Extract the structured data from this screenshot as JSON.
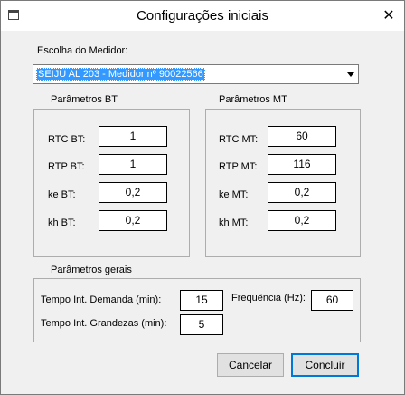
{
  "window": {
    "title": "Configurações iniciais",
    "close_glyph": "✕",
    "app_icon": "window-icon"
  },
  "meter": {
    "label": "Escolha do Medidor:",
    "selected": "SEIJU AL 203 - Medidor nº 90022566"
  },
  "bt": {
    "title": "Parâmetros BT",
    "fields": [
      {
        "label": "RTC BT:",
        "value": "1"
      },
      {
        "label": "RTP BT:",
        "value": "1"
      },
      {
        "label": "ke BT:",
        "value": "0,2"
      },
      {
        "label": "kh BT:",
        "value": "0,2"
      }
    ]
  },
  "mt": {
    "title": "Parâmetros MT",
    "fields": [
      {
        "label": "RTC MT:",
        "value": "60"
      },
      {
        "label": "RTP MT:",
        "value": "116"
      },
      {
        "label": "ke MT:",
        "value": "0,2"
      },
      {
        "label": "kh MT:",
        "value": "0,2"
      }
    ]
  },
  "general": {
    "title": "Parâmetros gerais",
    "demand_label": "Tempo Int. Demanda (min):",
    "demand_value": "15",
    "freq_label": "Frequência (Hz):",
    "freq_value": "60",
    "quantities_label": "Tempo Int. Grandezas (min):",
    "quantities_value": "5"
  },
  "buttons": {
    "cancel": "Cancelar",
    "finish": "Concluir"
  },
  "colors": {
    "selection": "#3399ff",
    "default_button_border": "#0078d7"
  }
}
